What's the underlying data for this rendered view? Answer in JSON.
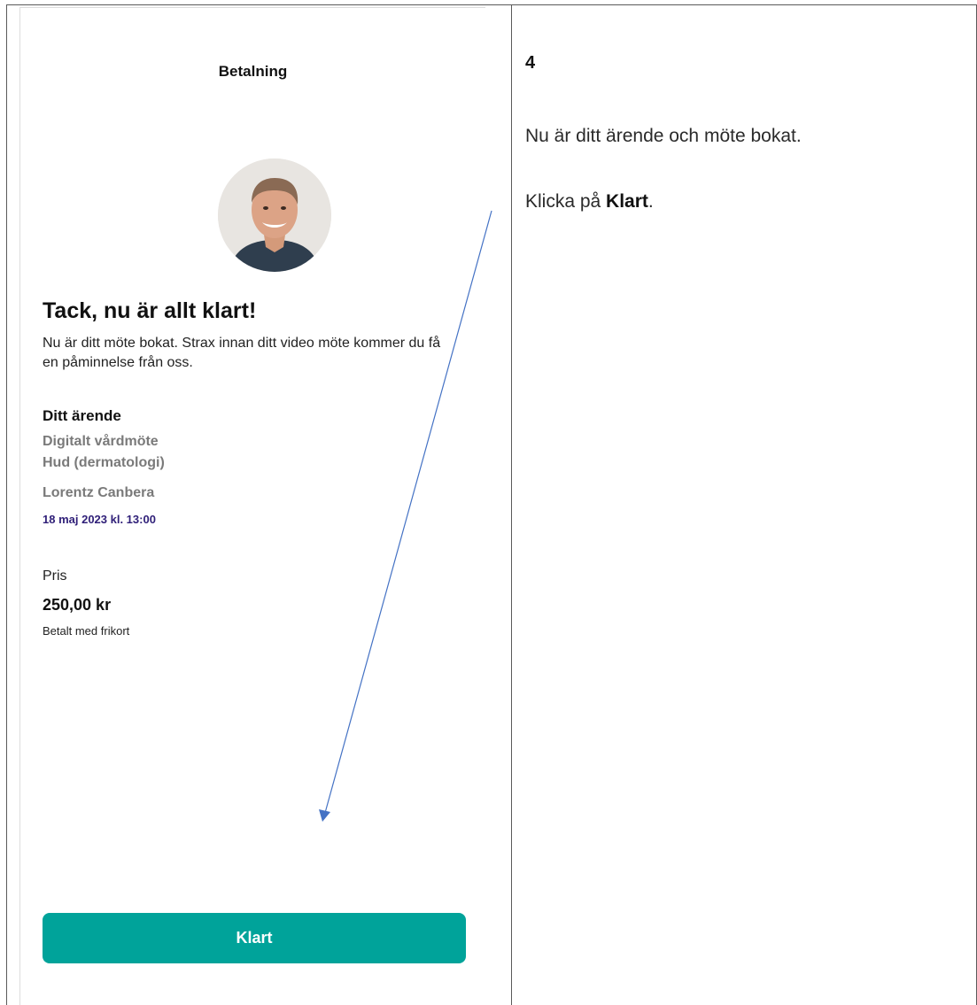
{
  "left": {
    "header_title": "Betalning",
    "heading": "Tack, nu är allt klart!",
    "intro": "Nu är ditt möte bokat. Strax innan ditt video möte kommer du få en påminnelse från oss.",
    "case": {
      "heading": "Ditt ärende",
      "type": "Digitalt vårdmöte",
      "specialty": "Hud (dermatologi)",
      "clinician": "Lorentz Canbera",
      "datetime": "18 maj 2023 kl. 13:00"
    },
    "price": {
      "label": "Pris",
      "amount": "250,00 kr",
      "note": "Betalt med frikort"
    },
    "button_label": "Klart"
  },
  "right": {
    "step": "4",
    "line1": "Nu är ditt ärende och möte bokat.",
    "line2_prefix": "Klicka på ",
    "line2_bold": "Klart",
    "line2_suffix": "."
  },
  "colors": {
    "button": "#00a39a",
    "date_text": "#2f1f78",
    "arrow": "#4472c4"
  }
}
